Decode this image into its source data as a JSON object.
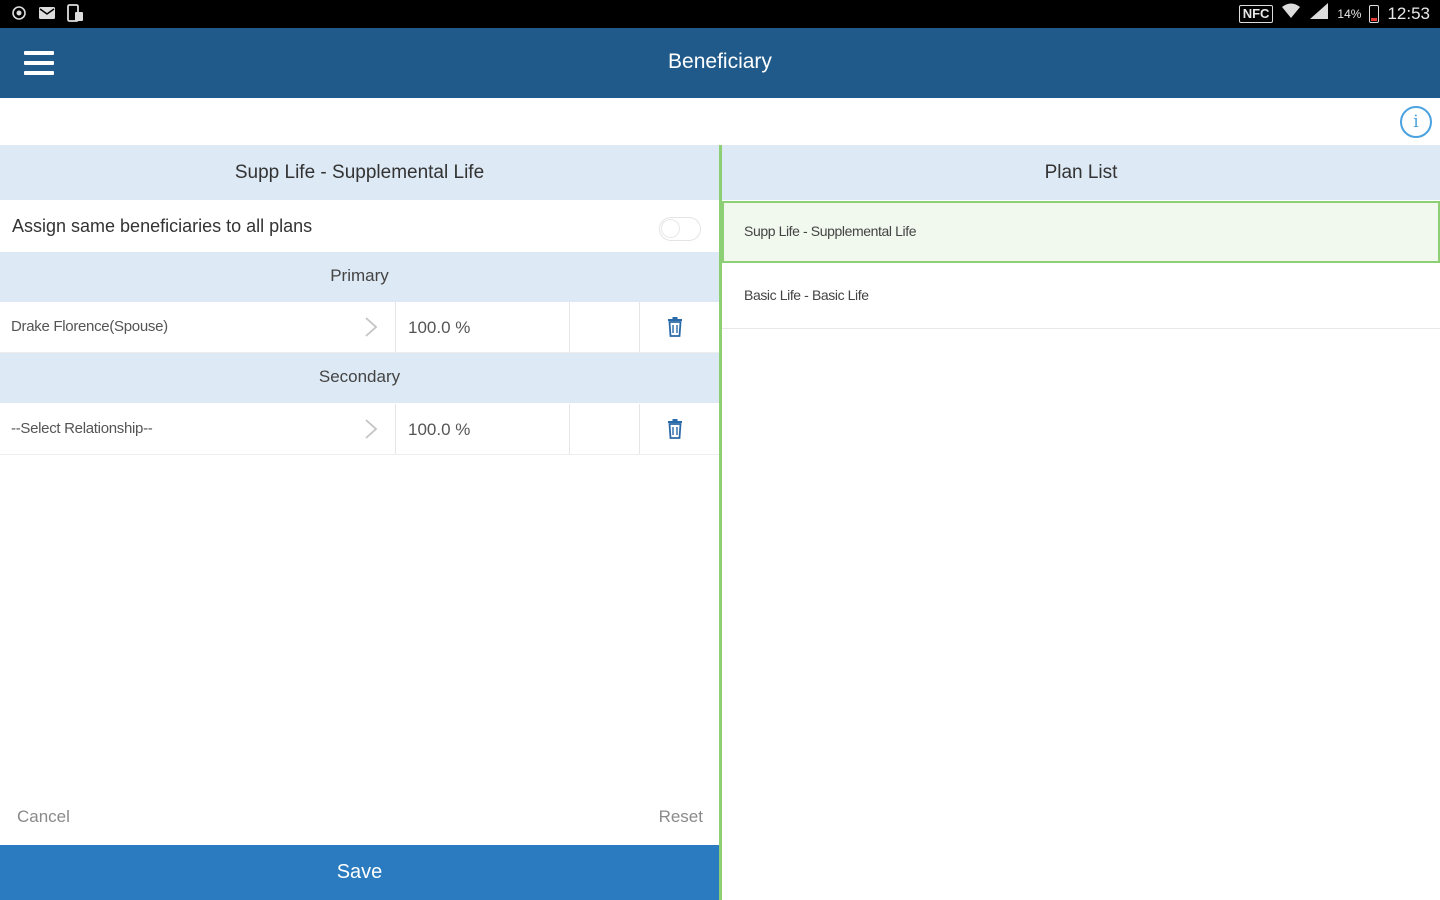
{
  "status_bar": {
    "time": "12:53",
    "battery_percent": "14%",
    "network_label": "NFC",
    "left_icons": [
      "location-icon",
      "mail-icon",
      "phone-storage-icon"
    ],
    "right_icons": [
      "wifi-icon",
      "signal-icon",
      "battery-icon"
    ]
  },
  "appbar": {
    "title": "Beneficiary",
    "menu_icon": "hamburger-menu-icon"
  },
  "info": {
    "icon_glyph": "i"
  },
  "left_panel": {
    "title": "Supp Life - Supplemental Life",
    "assign_label": "Assign same beneficiaries to all plans",
    "assign_toggle_on": false,
    "primary_header": "Primary",
    "secondary_header": "Secondary",
    "primary_row": {
      "name": "Drake Florence(Spouse)",
      "percent": "100.0 %"
    },
    "secondary_row": {
      "name": "--Select Relationship--",
      "percent": "100.0 %"
    },
    "cancel_label": "Cancel",
    "reset_label": "Reset",
    "save_label": "Save"
  },
  "right_panel": {
    "title": "Plan List",
    "plans": [
      {
        "label": "Supp Life - Supplemental Life",
        "selected": true
      },
      {
        "label": "Basic Life - Basic Life",
        "selected": false
      }
    ]
  },
  "colors": {
    "appbar": "#1f5a8b",
    "header_bg": "#dde9f4",
    "save_button": "#2a7bbf",
    "selected_border": "#8ccf74",
    "selected_bg": "#f1f8ee",
    "info_icon": "#4aa3df",
    "delete_icon": "#2a6aa8"
  }
}
